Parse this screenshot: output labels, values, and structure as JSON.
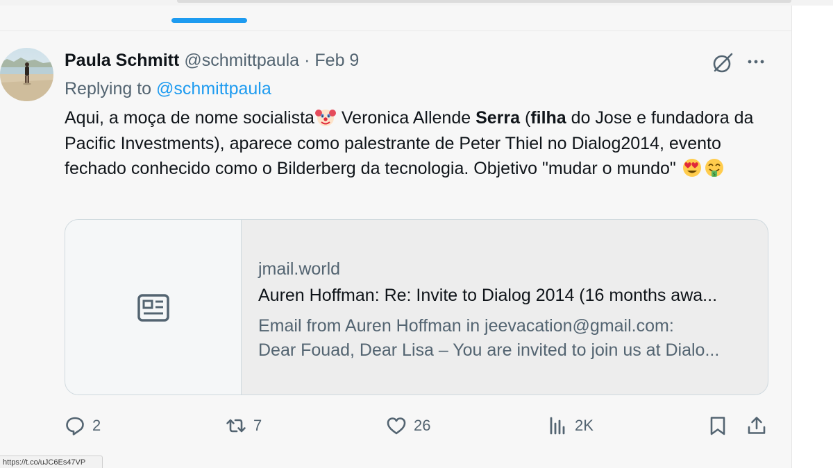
{
  "tweet": {
    "author_name": "Paula Schmitt",
    "author_handle": "@schmittpaula",
    "separator": "·",
    "date": "Feb 9",
    "replying_prefix": "Replying to ",
    "replying_mention": "@schmittpaula",
    "text": {
      "p1": "Aqui, a moça de nome socialista",
      "p2": " Veronica Allende ",
      "p3_bold": "Serra",
      "p4": " (",
      "p5_bold": "filha",
      "p6": " do Jose e fundadora da Pacific Investments), aparece como palestrante de Peter Thiel no Dialog2014, evento fechado conhecido como o Bilderberg da tecnologia. Objetivo \"mudar o mundo\" "
    },
    "emojis": [
      "clown-face",
      "smiling-face-with-heart-eyes",
      "money-mouth-face"
    ]
  },
  "card": {
    "domain": "jmail.world",
    "title": "Auren Hoffman: Re: Invite to Dialog 2014 (16 months awa...",
    "desc_line1": "Email from Auren Hoffman in jeevacation@gmail.com:",
    "desc_line2": "Dear Fouad, Dear Lisa – You are invited to join us at Dialo...",
    "icon": "article-icon"
  },
  "actions": {
    "replies": "2",
    "reposts": "7",
    "likes": "26",
    "views": "2K"
  },
  "status_url": "https://t.co/uJC6Es47VP",
  "colors": {
    "accent": "#1d9bf0",
    "text": "#0f1419",
    "secondary": "#536471",
    "background": "#f7f7f7"
  }
}
